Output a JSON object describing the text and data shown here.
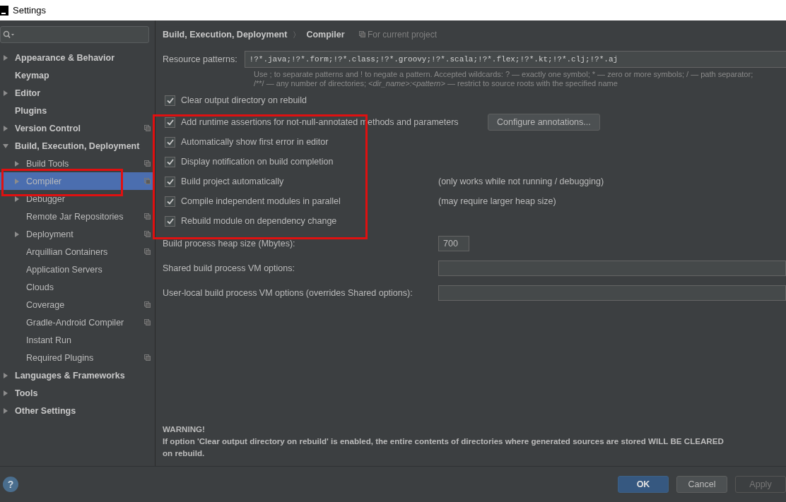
{
  "window": {
    "title": "Settings"
  },
  "sidebar": {
    "items": [
      {
        "label": "Appearance & Behavior",
        "expanded": false,
        "selected": false,
        "project": false
      },
      {
        "label": "Keymap",
        "selected": false,
        "project": false
      },
      {
        "label": "Editor",
        "expanded": false,
        "selected": false,
        "project": false
      },
      {
        "label": "Plugins",
        "selected": false,
        "project": false
      },
      {
        "label": "Version Control",
        "expanded": false,
        "selected": false,
        "project": true
      },
      {
        "label": "Build, Execution, Deployment",
        "expanded": true,
        "selected": false,
        "project": false,
        "children": [
          {
            "label": "Build Tools",
            "expanded": false,
            "selected": false,
            "project": true
          },
          {
            "label": "Compiler",
            "expanded": false,
            "selected": true,
            "project": true
          },
          {
            "label": "Debugger",
            "expanded": false,
            "selected": false,
            "project": false
          },
          {
            "label": "Remote Jar Repositories",
            "selected": false,
            "project": true
          },
          {
            "label": "Deployment",
            "expanded": false,
            "selected": false,
            "project": true
          },
          {
            "label": "Arquillian Containers",
            "selected": false,
            "project": true
          },
          {
            "label": "Application Servers",
            "selected": false,
            "project": false
          },
          {
            "label": "Clouds",
            "selected": false,
            "project": false
          },
          {
            "label": "Coverage",
            "selected": false,
            "project": true
          },
          {
            "label": "Gradle-Android Compiler",
            "selected": false,
            "project": true
          },
          {
            "label": "Instant Run",
            "selected": false,
            "project": false
          },
          {
            "label": "Required Plugins",
            "selected": false,
            "project": true
          }
        ]
      },
      {
        "label": "Languages & Frameworks",
        "expanded": false,
        "selected": false,
        "project": false
      },
      {
        "label": "Tools",
        "expanded": false,
        "selected": false,
        "project": false
      },
      {
        "label": "Other Settings",
        "expanded": false,
        "selected": false,
        "project": false
      }
    ]
  },
  "breadcrumb": {
    "path": [
      "Build, Execution, Deployment",
      "Compiler"
    ],
    "separator": "〉",
    "scope": "For current project"
  },
  "resource_patterns": {
    "label": "Resource patterns:",
    "value": "!?*.java;!?*.form;!?*.class;!?*.groovy;!?*.scala;!?*.flex;!?*.kt;!?*.clj;!?*.aj",
    "help": [
      "Use ; to separate patterns and ! to negate a pattern. Accepted wildcards: ? — exactly one symbol; * — zero or more symbols; / — path separator;",
      "/**/ — any number of directories; *<dir_name>:<pattern>* — restrict to source roots with the specified name"
    ]
  },
  "options": [
    {
      "label": "Clear output directory on rebuild",
      "checked": true
    },
    {
      "label": "Add runtime assertions for not-null-annotated methods and parameters",
      "checked": true,
      "button": "Configure annotations..."
    },
    {
      "label": "Automatically show first error in editor",
      "checked": true
    },
    {
      "label": "Display notification on build completion",
      "checked": true
    },
    {
      "label": "Build project automatically",
      "checked": true,
      "note": "(only works while not running / debugging)"
    },
    {
      "label": "Compile independent modules in parallel",
      "checked": true,
      "note": "(may require larger heap size)"
    },
    {
      "label": "Rebuild module on dependency change",
      "checked": true
    }
  ],
  "fields": [
    {
      "label": "Build process heap size (Mbytes):",
      "value": "700",
      "kind": "short"
    },
    {
      "label": "Shared build process VM options:",
      "kind": "wide"
    },
    {
      "label": "User-local build process VM options (overrides Shared options):",
      "kind": "wide"
    }
  ],
  "warning": {
    "title": "WARNING!",
    "lines": [
      "If option 'Clear output directory on rebuild' is enabled, the entire contents of directories where generated sources are stored WILL BE CLEARED",
      "on rebuild."
    ]
  },
  "help_button": "?",
  "buttons": [
    {
      "label": "OK",
      "kind": "primary"
    },
    {
      "label": "Cancel",
      "kind": "normal"
    },
    {
      "label": "Apply",
      "kind": "disabled"
    }
  ]
}
